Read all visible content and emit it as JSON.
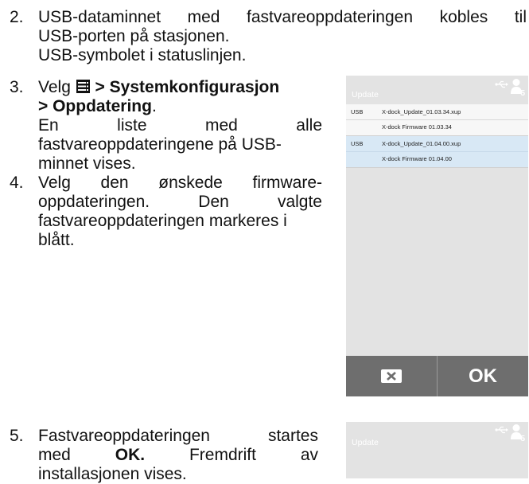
{
  "step2": {
    "number": "2.",
    "line1": "USB-dataminnet med fastvareoppdateringen kobles til",
    "line2": "USB-porten på stasjonen.",
    "line3": "USB-symbolet i statuslinjen."
  },
  "step3": {
    "number": "3.",
    "prefix": "Velg",
    "path1": " > Systemkonfigurasjon",
    "path2": "> Oppdatering",
    "path_end": ".",
    "line_a": "En liste med alle",
    "line_b": "fastvareoppdateringene på USB-",
    "line_c": "minnet vises."
  },
  "step4": {
    "number": "4.",
    "line1": "Velg den ønskede firmware-",
    "line2": "oppdateringen. Den valgte",
    "line3": "fastvareoppdateringen markeres i",
    "line4": "blått."
  },
  "step5": {
    "number": "5.",
    "line1": "Fastvareoppdateringen startes",
    "line2_pre": "med ",
    "line2_bold": "OK.",
    "line2_post": " Fremdrift av",
    "line3": "installasjonen vises."
  },
  "screen1": {
    "title": "Update",
    "updates": [
      {
        "source": "USB",
        "file": "X-dock_Update_01.03.34.xup",
        "firmware": "X-dock Firmware 01.03.34",
        "selected": false
      },
      {
        "source": "USB",
        "file": "X-dock_Update_01.04.00.xup",
        "firmware": "X-dock Firmware 01.04.00",
        "selected": true
      }
    ],
    "ok_label": "OK",
    "user_index": "5",
    "icons": {
      "usb": "usb-icon",
      "user": "user-icon",
      "cancel": "cancel-x-icon"
    },
    "colors": {
      "background": "#e3e3e3",
      "selected_row": "#d8e8f5",
      "bottom_bar": "#6e6e6e"
    }
  },
  "screen2": {
    "title": "Update",
    "user_index": "5"
  }
}
